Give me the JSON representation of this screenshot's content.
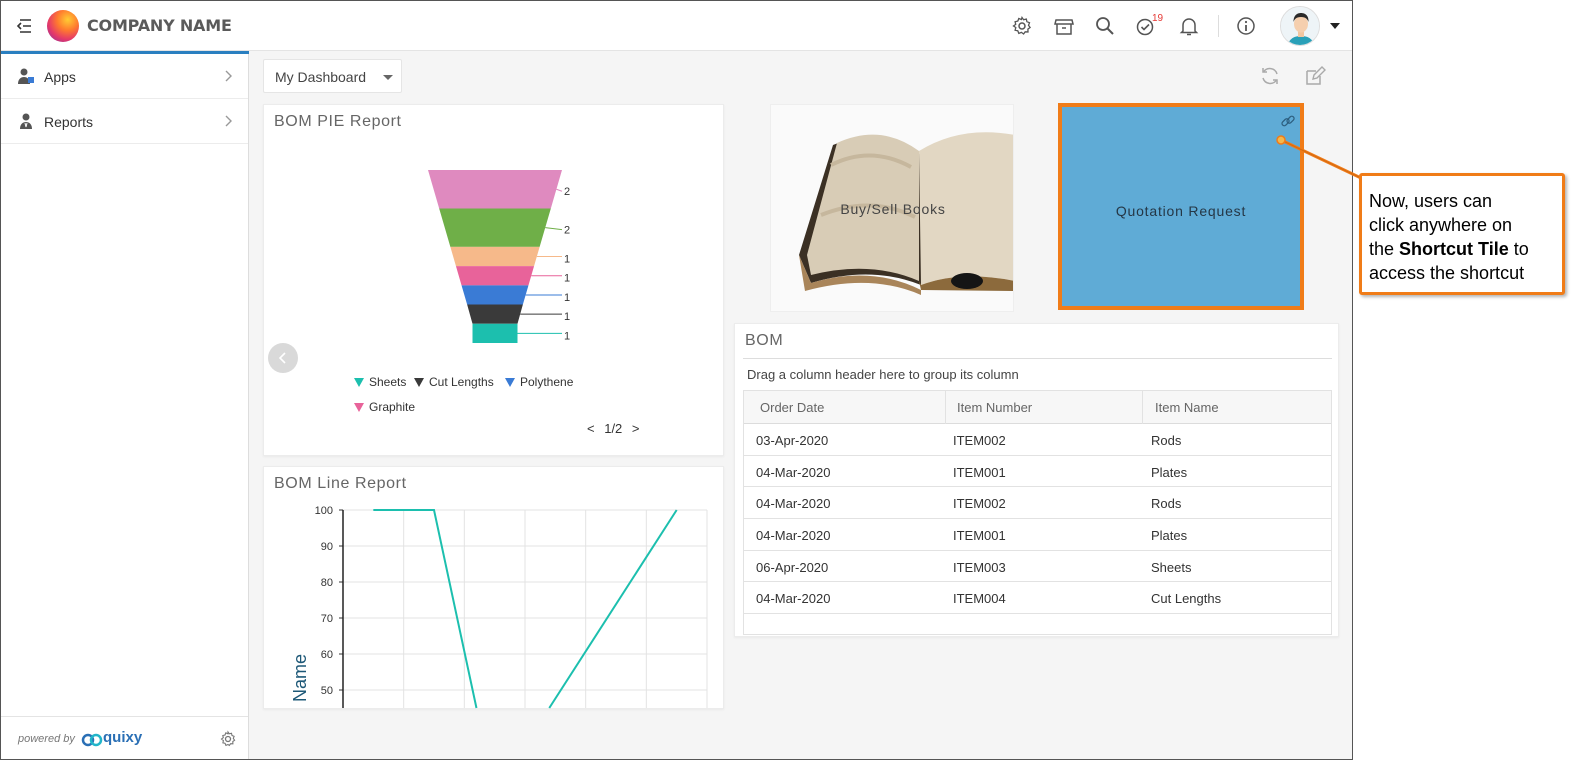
{
  "header": {
    "brand": "COMPANY NAME",
    "notification_count": "19",
    "icons": [
      "menu-collapse-icon",
      "gear-icon",
      "store-icon",
      "search-icon",
      "tasks-check-icon",
      "bell-icon",
      "info-icon"
    ]
  },
  "sidebar": {
    "items": [
      {
        "label": "Apps",
        "icon": "apps-user-icon"
      },
      {
        "label": "Reports",
        "icon": "reports-user-icon"
      }
    ],
    "footer": {
      "powered_by": "powered by",
      "brand": "quixy"
    }
  },
  "toolbar": {
    "dashboard_select": "My Dashboard"
  },
  "pie_report": {
    "title": "BOM PIE Report",
    "pager": {
      "prev": "<",
      "page": "1/2",
      "next": ">"
    },
    "legend": [
      {
        "label": "Sheets",
        "color": "#1cbfae"
      },
      {
        "label": "Cut Lengths",
        "color": "#3a3a3a"
      },
      {
        "label": "Polythene",
        "color": "#3a7bd5"
      },
      {
        "label": "Graphite",
        "color": "#e8639a"
      }
    ]
  },
  "line_report": {
    "title": "BOM Line Report",
    "ylabel": "Name"
  },
  "tiles": [
    {
      "label": "Buy/Sell Books"
    },
    {
      "label": "Quotation Request",
      "color": "#5fabd6"
    }
  ],
  "bom": {
    "title": "BOM",
    "group_hint": "Drag a column header here to group its column",
    "columns": [
      "Order Date",
      "Item Number",
      "Item Name"
    ],
    "rows": [
      [
        "03-Apr-2020",
        "ITEM002",
        "Rods"
      ],
      [
        "04-Mar-2020",
        "ITEM001",
        "Plates"
      ],
      [
        "04-Mar-2020",
        "ITEM002",
        "Rods"
      ],
      [
        "04-Mar-2020",
        "ITEM001",
        "Plates"
      ],
      [
        "06-Apr-2020",
        "ITEM003",
        "Sheets"
      ],
      [
        "04-Mar-2020",
        "ITEM004",
        "Cut Lengths"
      ]
    ]
  },
  "callout": {
    "line1": "Now, users can",
    "line2": "click anywhere on",
    "line3_pre": "the ",
    "line3_bold": "Shortcut Tile",
    "line3_post": " to",
    "line4": "access the shortcut",
    "accent": "#f07c18"
  },
  "chart_data": [
    {
      "type": "funnel",
      "title": "BOM PIE Report",
      "series": [
        {
          "values": [
            2,
            2,
            1,
            1,
            1,
            1,
            1
          ]
        }
      ],
      "colors": [
        "#df8abf",
        "#6faf48",
        "#f6b98a",
        "#e8639a",
        "#3a7bd5",
        "#3a3a3a",
        "#1cbfae"
      ]
    },
    {
      "type": "line",
      "title": "BOM Line Report",
      "ylabel": "Name",
      "yticks": [
        100,
        90,
        80,
        70,
        60,
        50
      ],
      "ylim": [
        45,
        100
      ],
      "series": [
        {
          "color": "#1cbfae",
          "points": [
            [
              0.5,
              100
            ],
            [
              1.5,
              100
            ],
            [
              2.2,
              45
            ],
            [
              3.4,
              45
            ],
            [
              5.5,
              100
            ]
          ]
        }
      ],
      "xlim": [
        0,
        6
      ],
      "grid": true
    }
  ]
}
